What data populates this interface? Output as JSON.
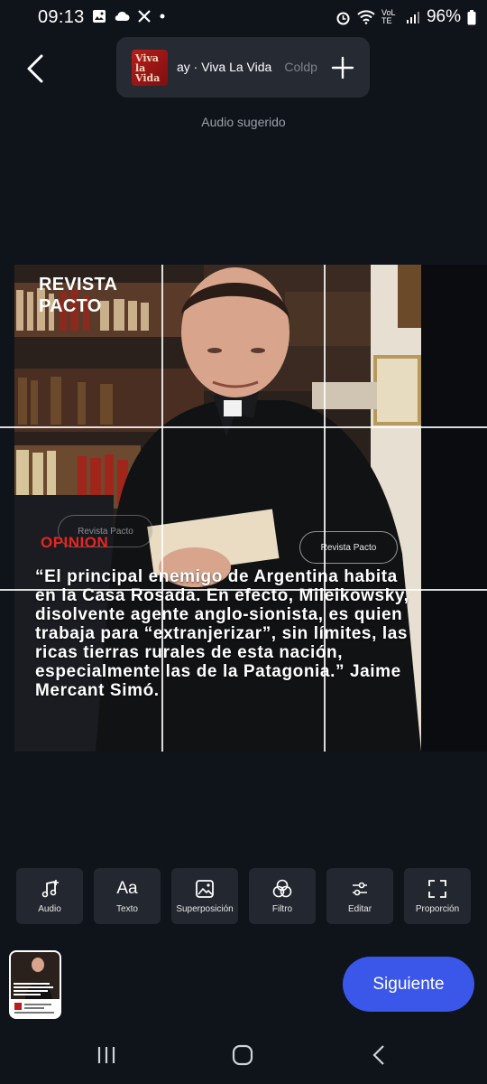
{
  "status_bar": {
    "time": "09:13",
    "battery": "96%",
    "network_label": "VoLTE"
  },
  "header": {
    "track_title": "ay · Viva La Vida",
    "track_artist": "Coldp",
    "hint": "Audio sugerido"
  },
  "post": {
    "brand": [
      "REVISTA",
      "PACTO"
    ],
    "category": "OPINION",
    "chip_right": "Revista Pacto",
    "chip_left": "Revista Pacto",
    "quote": "“El principal enemigo de Argentina habita en la Casa Rosada. En efecto, Mileikowsky, disolvente agente anglo-sionista, es quien trabaja para “extranjerizar”, sin límites, las ricas tierras rurales de esta nación, especialmente las de la Patagonia.” Jaime Mercant Simó."
  },
  "album_art_text": "Viva la Vida",
  "tools": [
    {
      "icon": "music-note-add-icon",
      "label": "Audio"
    },
    {
      "icon": "text-icon",
      "label": "Texto"
    },
    {
      "icon": "image-icon",
      "label": "Superposición"
    },
    {
      "icon": "filter-icon",
      "label": "Filtro"
    },
    {
      "icon": "sliders-icon",
      "label": "Editar"
    },
    {
      "icon": "crop-frame-icon",
      "label": "Proporción"
    }
  ],
  "tool_text_glyph": "Aa",
  "next_label": "Siguiente",
  "colors": {
    "accent": "#3a57ea",
    "category_red": "#e5271f",
    "background": "#0f131a"
  }
}
